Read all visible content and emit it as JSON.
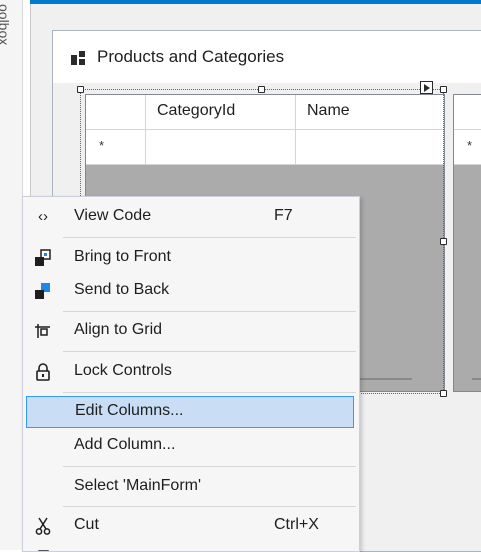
{
  "toolbox": {
    "label": "oolbox"
  },
  "form": {
    "title": "Products and Categories"
  },
  "grid": {
    "columns": [
      "",
      "CategoryId",
      "Name"
    ],
    "new_row_glyph": "*"
  },
  "grid2": {
    "new_row_glyph": "*"
  },
  "context_menu": {
    "items": [
      {
        "label": "View Code",
        "shortcut": "F7",
        "icon": "code-icon"
      },
      {
        "label": "Bring to Front",
        "shortcut": "",
        "icon": "bring-to-front-icon"
      },
      {
        "label": "Send to Back",
        "shortcut": "",
        "icon": "send-to-back-icon"
      },
      {
        "label": "Align to Grid",
        "shortcut": "",
        "icon": "align-to-grid-icon"
      },
      {
        "label": "Lock Controls",
        "shortcut": "",
        "icon": "lock-icon"
      },
      {
        "label": "Edit Columns...",
        "shortcut": "",
        "icon": "",
        "highlighted": true
      },
      {
        "label": "Add Column...",
        "shortcut": "",
        "icon": ""
      },
      {
        "label": "Select 'MainForm'",
        "shortcut": "",
        "icon": ""
      },
      {
        "label": "Cut",
        "shortcut": "Ctrl+X",
        "icon": "cut-icon"
      }
    ]
  },
  "colors": {
    "accent": "#007acc",
    "menu_highlight": "#c9def5",
    "menu_highlight_border": "#3399ff",
    "grid_background": "#ababab"
  }
}
